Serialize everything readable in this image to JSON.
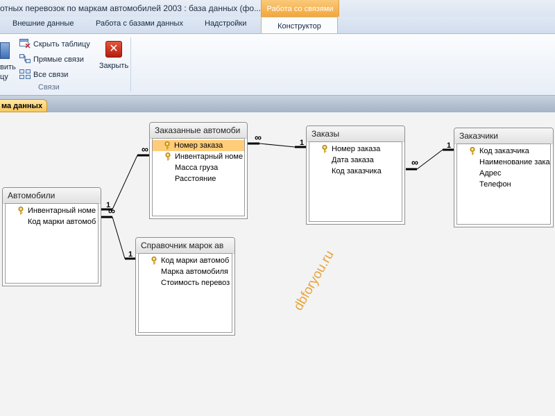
{
  "window": {
    "title": "отных перевозок по маркам автомобилей 2003 : база данных (фо...",
    "context_tab_title": "Работа со связями"
  },
  "ribbon_tabs": [
    {
      "label": "Внешние данные"
    },
    {
      "label": "Работа с базами данных"
    },
    {
      "label": "Надстройки"
    },
    {
      "label": "Конструктор",
      "active": true
    }
  ],
  "ribbon": {
    "cut_button_label_line1": "вить",
    "cut_button_label_line2": "цу",
    "hide_table": "Скрыть таблицу",
    "direct_links": "Прямые связи",
    "all_links": "Все связи",
    "delete": "Закрыть",
    "group_label": "Связи"
  },
  "document_tab": "ма данных",
  "watermark": "dbforyou.ru",
  "tables": [
    {
      "id": "cars",
      "title": "Автомобили",
      "fields": [
        {
          "name": "Инвентарный номе",
          "key": true
        },
        {
          "name": "Код марки автомоб",
          "key": false
        }
      ]
    },
    {
      "id": "ordered-cars",
      "title": "Заказанные автомоби",
      "fields": [
        {
          "name": "Номер заказа",
          "key": true,
          "selected": true
        },
        {
          "name": "Инвентарный номе",
          "key": true
        },
        {
          "name": "Масса груза",
          "key": false
        },
        {
          "name": "Расстояние",
          "key": false
        }
      ]
    },
    {
      "id": "orders",
      "title": "Заказы",
      "fields": [
        {
          "name": "Номер заказа",
          "key": true
        },
        {
          "name": "Дата заказа",
          "key": false
        },
        {
          "name": "Код заказчика",
          "key": false
        }
      ]
    },
    {
      "id": "customers",
      "title": "Заказчики",
      "fields": [
        {
          "name": "Код заказчика",
          "key": true
        },
        {
          "name": "Наименование заказ",
          "key": false
        },
        {
          "name": "Адрес",
          "key": false
        },
        {
          "name": "Телефон",
          "key": false
        }
      ]
    },
    {
      "id": "brands",
      "title": "Справочник марок ав",
      "fields": [
        {
          "name": "Код марки автомоб",
          "key": true
        },
        {
          "name": "Марка автомобиля",
          "key": false
        },
        {
          "name": "Стоимость перевоз",
          "key": false
        }
      ]
    }
  ],
  "relationships": [
    {
      "from": "cars",
      "to": "ordered-cars",
      "one_label": "1",
      "many_label": "∞"
    },
    {
      "from": "orders",
      "to": "ordered-cars",
      "one_label": "1",
      "many_label": "∞"
    },
    {
      "from": "customers",
      "to": "orders",
      "one_label": "1",
      "many_label": "∞"
    },
    {
      "from": "brands",
      "to": "cars",
      "one_label": "1",
      "many_label": "∞"
    }
  ]
}
